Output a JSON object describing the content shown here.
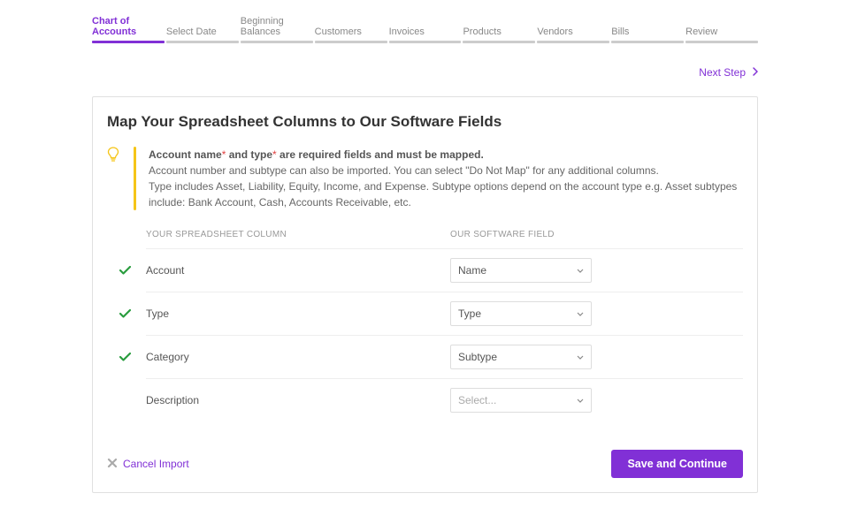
{
  "steps": {
    "items": [
      {
        "label": "Chart of Accounts",
        "active": true
      },
      {
        "label": "Select Date",
        "active": false
      },
      {
        "label": "Beginning\nBalances",
        "active": false
      },
      {
        "label": "Customers",
        "active": false
      },
      {
        "label": "Invoices",
        "active": false
      },
      {
        "label": "Products",
        "active": false
      },
      {
        "label": "Vendors",
        "active": false
      },
      {
        "label": "Bills",
        "active": false
      },
      {
        "label": "Review",
        "active": false
      }
    ]
  },
  "nextStep": {
    "label": "Next Step"
  },
  "card": {
    "title": "Map Your Spreadsheet Columns to Our Software Fields",
    "info": {
      "req_prefix": "Account name",
      "req_mid": " and type",
      "req_suffix": " are required fields and must be mapped.",
      "line2": "Account number and subtype can also be imported. You can select \"Do Not Map\" for any additional columns.",
      "line3": "Type includes Asset, Liability, Equity, Income, and Expense. Subtype options depend on the account type e.g. Asset subtypes include: Bank Account, Cash, Accounts Receivable, etc."
    },
    "headers": {
      "col1": "Your Spreadsheet Column",
      "col2": "Our Software Field"
    },
    "rows": [
      {
        "mapped": true,
        "source": "Account",
        "target": "Name",
        "placeholder": false
      },
      {
        "mapped": true,
        "source": "Type",
        "target": "Type",
        "placeholder": false
      },
      {
        "mapped": true,
        "source": "Category",
        "target": "Subtype",
        "placeholder": false
      },
      {
        "mapped": false,
        "source": "Description",
        "target": "Select...",
        "placeholder": true
      }
    ],
    "footer": {
      "cancel": "Cancel Import",
      "save": "Save and Continue"
    }
  }
}
